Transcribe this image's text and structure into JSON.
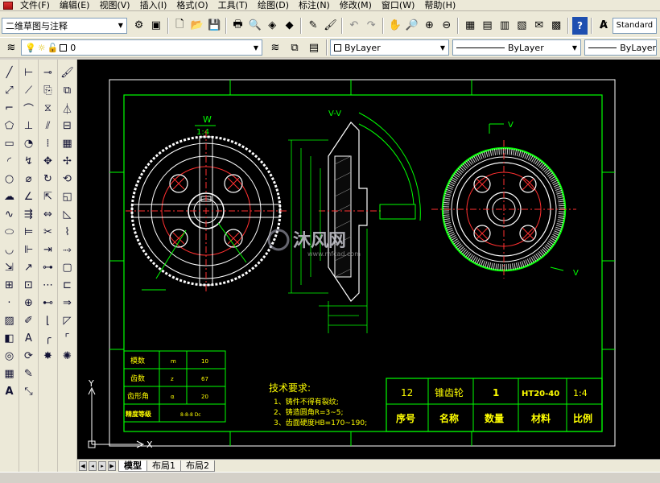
{
  "menu": [
    "文件(F)",
    "编辑(E)",
    "视图(V)",
    "插入(I)",
    "格式(O)",
    "工具(T)",
    "绘图(D)",
    "标注(N)",
    "修改(M)",
    "窗口(W)",
    "帮助(H)"
  ],
  "workspace": {
    "value": "二维草图与注释"
  },
  "text_style": {
    "value": "Standard"
  },
  "layer": {
    "value": "0"
  },
  "color": {
    "value": "ByLayer"
  },
  "linetype": {
    "value": "ByLayer"
  },
  "lineweight": {
    "value": "ByLayer"
  },
  "tabs": [
    "模型",
    "布局1",
    "布局2"
  ],
  "drawing": {
    "view_label": "W",
    "view_scale": "1:4",
    "section_label": "V-V",
    "v_label": "V",
    "v_label2": "V",
    "params": [
      {
        "name": "模数",
        "sym": "m",
        "val": "10"
      },
      {
        "name": "齿数",
        "sym": "z",
        "val": "67"
      },
      {
        "name": "齿形角",
        "sym": "α",
        "val": "20"
      },
      {
        "name": "精度等级",
        "sym": "",
        "val": "8-8-8 Dc"
      }
    ],
    "tech_title": "技术要求:",
    "tech_items": [
      "1、铸件不得有裂纹;",
      "2、铸造圆角R=3~5;",
      "3、齿面硬度HB=170~190;"
    ],
    "title_block": {
      "values": [
        "12",
        "锥齿轮",
        "1",
        "HT20-40",
        "1:4"
      ],
      "headers": [
        "序号",
        "名称",
        "数量",
        "材料",
        "比例"
      ]
    },
    "watermark": "沐风网",
    "watermark_url": "www.mfcad.com",
    "ucs_x": "X",
    "ucs_y": "Y"
  }
}
